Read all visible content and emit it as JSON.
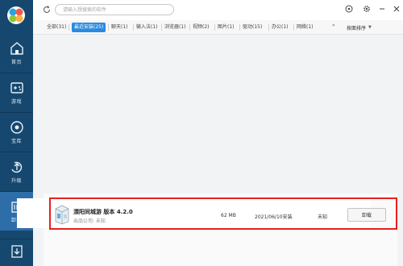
{
  "sidebar": {
    "items": [
      {
        "label": "首页",
        "icon": "home-icon"
      },
      {
        "label": "游戏",
        "icon": "gamepad-icon"
      },
      {
        "label": "宝库",
        "icon": "treasury-icon"
      },
      {
        "label": "升级",
        "icon": "upgrade-icon"
      },
      {
        "label": "卸载",
        "icon": "trash-icon"
      },
      {
        "label": "",
        "icon": "download-icon"
      }
    ],
    "active_index": 4
  },
  "search": {
    "placeholder": "请输入想搜索的软件"
  },
  "tabs": [
    {
      "label": "全部(31)"
    },
    {
      "label": "最近安装(25)"
    },
    {
      "label": "聊天(1)"
    },
    {
      "label": "输入法(1)"
    },
    {
      "label": "浏览器(1)"
    },
    {
      "label": "视频(2)"
    },
    {
      "label": "图片(1)"
    },
    {
      "label": "驱动(15)"
    },
    {
      "label": "办公(1)"
    },
    {
      "label": "网络(1)"
    }
  ],
  "tabs_more": "»",
  "sort_label": "按面排序",
  "app": {
    "name": "漂阳同城游 版本 4.2.0",
    "company": "出品公司: 未知",
    "size": "62 MB",
    "install_date": "2021/06/10安装",
    "status": "未知",
    "action_label": "卸载"
  },
  "colors": {
    "sidebar_bg": "#16486f",
    "sidebar_active": "#2e6ea8",
    "tab_active": "#2a8ae0",
    "highlight": "#e8201c"
  }
}
